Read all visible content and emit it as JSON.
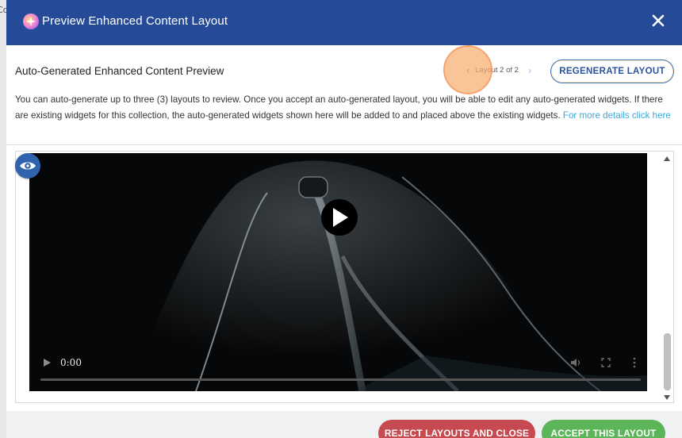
{
  "background": {
    "edge_text": "Co"
  },
  "modal": {
    "title": "Preview Enhanced Content Layout",
    "header_color": "#254a97"
  },
  "preview": {
    "heading": "Auto-Generated Enhanced Content Preview",
    "pager_label": "Layout 2 of 2",
    "regenerate_label": "REGENERATE LAYOUT",
    "description": "You can auto-generate up to three (3) layouts to review. Once you accept an auto-generated layout, you will be able to edit any auto-generated widgets. If there are existing widgets for this collection, the auto-generated widgets shown here will be added to and placed above the existing widgets.",
    "link_text": "For more details click here"
  },
  "video": {
    "time": "0:00",
    "icons": [
      "eye-icon",
      "play-icon",
      "volume-icon",
      "fullscreen-icon",
      "more-icon"
    ]
  },
  "footer": {
    "reject_label": "REJECT LAYOUTS AND CLOSE",
    "accept_label": "ACCEPT THIS LAYOUT",
    "reject_color": "#c64a4f",
    "accept_color": "#5db55a"
  }
}
